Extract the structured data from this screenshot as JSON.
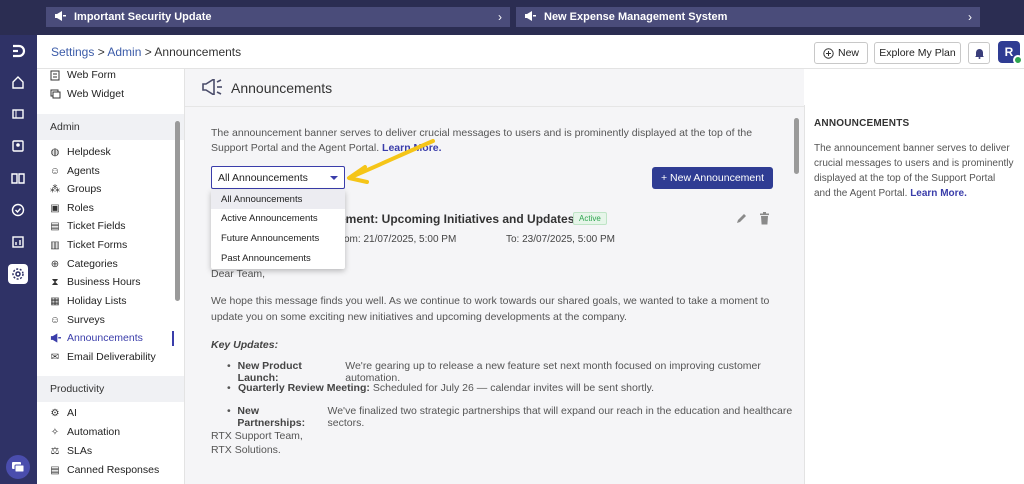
{
  "banners": [
    {
      "text": "Important Security Update"
    },
    {
      "text": "New Expense Management System"
    }
  ],
  "breadcrumb": {
    "settings": "Settings",
    "sep1": " > ",
    "admin": "Admin",
    "sep2": " > ",
    "current": "Announcements"
  },
  "header": {
    "new_label": "New",
    "explore_label": "Explore My Plan",
    "avatar_initial": "R"
  },
  "sidebar": {
    "top_items": [
      "Web Form",
      "Web Widget"
    ],
    "admin_heading": "Admin",
    "admin_items": [
      "Helpdesk",
      "Agents",
      "Groups",
      "Roles",
      "Ticket Fields",
      "Ticket Forms",
      "Categories",
      "Business Hours",
      "Holiday Lists",
      "Surveys",
      "Announcements",
      "Email Deliverability"
    ],
    "productivity_heading": "Productivity",
    "productivity_items": [
      "AI",
      "Automation",
      "SLAs",
      "Canned Responses"
    ]
  },
  "main": {
    "title": "Announcements",
    "intro": "The announcement banner serves to deliver crucial messages to users and is prominently displayed at the top of the Support Portal and the Agent Portal.",
    "learn_more": "Learn More.",
    "filter_value": "All Announcements",
    "new_button": "+ New Announcement",
    "card_title": "ement: Upcoming Initiatives and Updates",
    "status": "Active",
    "from": "om: 21/07/2025, 5:00 PM",
    "to": "To: 23/07/2025, 5:00 PM",
    "greeting": "Dear Team,",
    "paragraph": "We hope this message finds you well. As we continue to work towards our shared goals, we wanted to take a moment to update you on some exciting new initiatives and upcoming developments at the company.",
    "key_updates": "Key Updates:",
    "bullets": [
      {
        "label": "New Product Launch:",
        "text": "We're gearing up to release a new feature set next month focused on improving customer automation."
      },
      {
        "label": "Quarterly Review Meeting:",
        "text": "Scheduled for July 26 — calendar invites will be sent shortly."
      },
      {
        "label": "New Partnerships:",
        "text": "We've finalized two strategic partnerships that will expand our reach in the education and healthcare sectors."
      }
    ],
    "signoff1": "RTX Support Team,",
    "signoff2": "RTX Solutions."
  },
  "dropdown": {
    "options": [
      "All Announcements",
      "Active Announcements",
      "Future Announcements",
      "Past Announcements"
    ]
  },
  "right_panel": {
    "heading": "ANNOUNCEMENTS",
    "text": "The announcement banner serves to deliver crucial messages to users and is prominently displayed at the top of the Support Portal and the Agent Portal.",
    "learn_more": "Learn More."
  },
  "colors": {
    "primary": "#2f3c93",
    "rail": "#2f3266",
    "topbar": "#2b2d52",
    "active_badge": "#2ea44f",
    "annotation": "#f5c518"
  }
}
